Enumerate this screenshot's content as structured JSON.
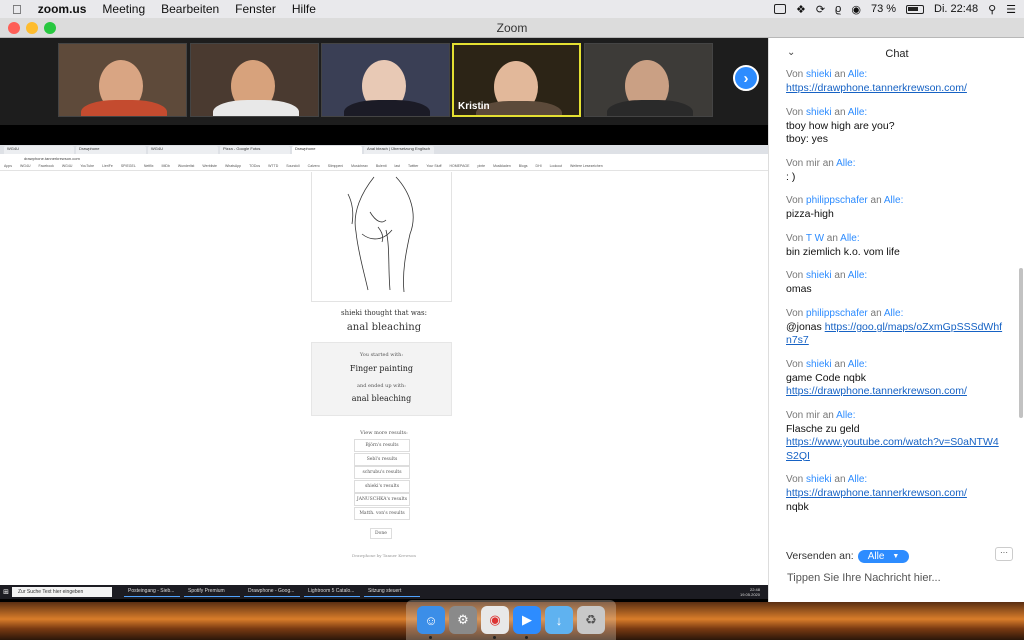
{
  "menubar": {
    "app": "zoom.us",
    "items": [
      "Meeting",
      "Bearbeiten",
      "Fenster",
      "Hilfe"
    ],
    "battery": "73 %",
    "clock": "Di. 22:48"
  },
  "window": {
    "title": "Zoom"
  },
  "gallery": {
    "active_name": "Kristin",
    "tiles": [
      {
        "bg": "#5e4a3a",
        "face": "#d9a583",
        "body": "#c44b2f"
      },
      {
        "bg": "#4a3a30",
        "face": "#d7a27c",
        "body": "#e8e8e8"
      },
      {
        "bg": "#3a3f55",
        "face": "#e8c9b5",
        "body": "#1b1b26"
      },
      {
        "bg": "#2c2416",
        "face": "#e2b89a",
        "body": "#5c4a3a"
      },
      {
        "bg": "#3d3b38",
        "face": "#caa084",
        "body": "#2a2a2a"
      }
    ]
  },
  "browser": {
    "tabs": [
      "WG4U",
      "Drawphone",
      "WG4U",
      "Pizza - Google Fotos",
      "Drawphone",
      "Anal bleach | Übersetzung Englisch"
    ],
    "url": "drawphone.tannerkrewson.com",
    "bookmarks": [
      "Apps",
      "WG4U",
      "Facebook",
      "WG4U",
      "YouTube",
      "LieriFe",
      "SPIEGEL",
      "Netflix",
      "IMDb",
      "Wunderlist",
      "Werbliste",
      "WhatsApp",
      "TODos",
      "WTTD",
      "Soundcli",
      "Calvero",
      "Slimppeni",
      "Musicheav",
      "Bulenti",
      "last",
      "Twitter",
      "Your Stuff",
      "HOMEPAGE",
      "pinte",
      "Musikladen",
      "Blogs",
      "DHI",
      "Lookout",
      "Weitere Lesezeichen"
    ]
  },
  "drawphone": {
    "thought": "shieki thought that was:",
    "answer": "anal bleaching",
    "started_label": "You started with:",
    "started": "Finger painting",
    "ended_label": "and ended up with:",
    "ended": "anal bleaching",
    "more_label": "View more results:",
    "results": [
      "Björn's results",
      "Sebl's results",
      "schrubu's results",
      "shieki's results",
      "JANUSCHKA's results",
      "Matth. von's results"
    ],
    "done": "Done",
    "credit": "Drawphone by Tanner Krewson"
  },
  "taskbar": {
    "search": "Zur Suche Text hier eingeben",
    "tasks": [
      "Posteingang - Sieb...",
      "",
      "Spotify Premium",
      "Drawphone - Goog...",
      "",
      "Lightroom 5 Catalo...",
      "Sitzung steuert"
    ],
    "time": "22:48",
    "date": "19.05.2020"
  },
  "chat": {
    "title": "Chat",
    "messages": [
      {
        "from": "shieki",
        "self": false,
        "lines": [
          "https://drawphone.tannerkrewson.com/"
        ],
        "links": [
          0
        ]
      },
      {
        "from": "shieki",
        "self": false,
        "lines": [
          "tboy how high are you?",
          "tboy: yes"
        ],
        "links": []
      },
      {
        "from": "mir",
        "self": true,
        "lines": [
          ": )"
        ],
        "links": []
      },
      {
        "from": "philippschafer",
        "self": false,
        "lines": [
          "pizza-high"
        ],
        "links": []
      },
      {
        "from": "T W",
        "self": false,
        "lines": [
          "bin ziemlich k.o. vom life"
        ],
        "links": []
      },
      {
        "from": "shieki",
        "self": false,
        "lines": [
          "omas"
        ],
        "links": []
      },
      {
        "from": "philippschafer",
        "self": false,
        "lines": [
          "@jonas https://goo.gl/maps/oZxmGpSSSdWhfn7s7"
        ],
        "links": [
          0
        ]
      },
      {
        "from": "shieki",
        "self": false,
        "lines": [
          "game Code nqbk",
          "https://drawphone.tannerkrewson.com/"
        ],
        "links": [
          1
        ]
      },
      {
        "from": "mir",
        "self": true,
        "lines": [
          "Flasche zu geld",
          "https://www.youtube.com/watch?v=S0aNTW4S2QI"
        ],
        "links": [
          1
        ]
      },
      {
        "from": "shieki",
        "self": false,
        "lines": [
          "https://drawphone.tannerkrewson.com/",
          "nqbk"
        ],
        "links": [
          0
        ]
      }
    ],
    "von": "Von",
    "an": "an",
    "alle": "Alle:",
    "send_label": "Versenden an:",
    "send_to": "Alle",
    "more": "···",
    "input_placeholder": "Tippen Sie Ihre Nachricht hier..."
  }
}
